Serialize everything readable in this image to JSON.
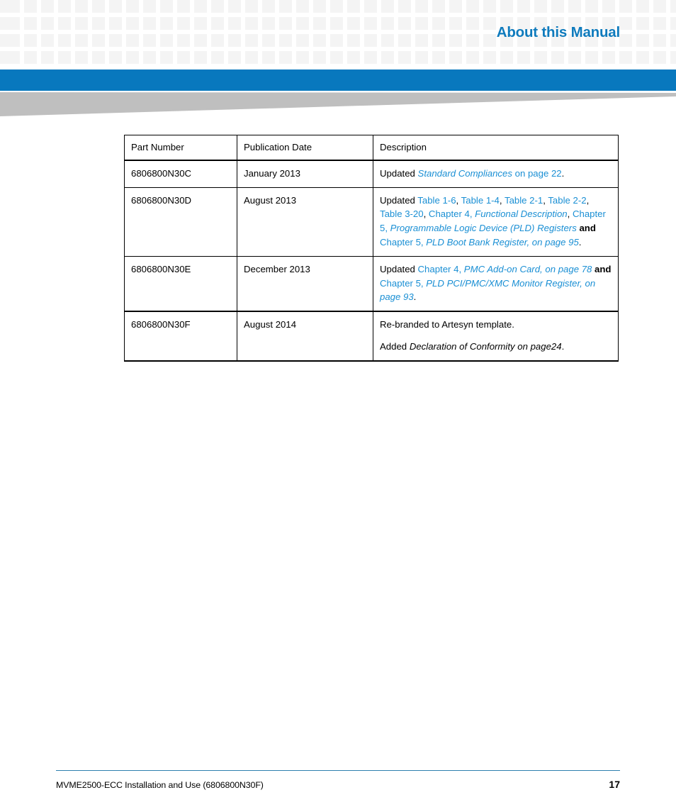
{
  "header": {
    "title": "About this Manual",
    "title_color": "#0f7bbd",
    "band_color": "#0878be",
    "wedge_color": "#bfbfbf",
    "pattern_square_color": "#f4f4f4"
  },
  "table": {
    "columns": [
      "Part Number",
      "Publication Date",
      "Description"
    ],
    "rows": [
      {
        "part_number": "6806800N30C",
        "publication_date": "January 2013",
        "description_plain": "Updated Standard Compliances on page 22."
      },
      {
        "part_number": "6806800N30D",
        "publication_date": "August 2013",
        "description_plain": "Updated Table 1-6, Table 1-4, Table 2-1, Table 2-2, Table 3-20, Chapter 4, Functional Description, Chapter 5, Programmable Logic Device (PLD) Registers and Chapter 5, PLD Boot Bank Register, on page 95."
      },
      {
        "part_number": "6806800N30E",
        "publication_date": "December 2013",
        "description_plain": "Updated Chapter 4, PMC Add-on Card, on page 78 and Chapter 5, PLD PCI/PMC/XMC Monitor Register, on page 93."
      },
      {
        "part_number": "6806800N30F",
        "publication_date": "August 2014",
        "description_plain": "Re-branded to Artesyn template. Added Declaration of Conformity on page24."
      }
    ],
    "row1_desc": {
      "lead": "Updated ",
      "link_italic": "Standard Compliances",
      "link_rest": " on page 22",
      "period": "."
    },
    "row2_desc": {
      "lead": "Updated ",
      "t1": "Table 1-6",
      "sep1": ", ",
      "t2": "Table 1-4",
      "sep2": ", ",
      "t3": "Table 2-1",
      "sep3": ", ",
      "t4": "Table 2-2",
      "sep4": ", ",
      "t5": "Table 3-20",
      "sep5": ", ",
      "c4": "Chapter 4, ",
      "c4_italic": "Functional Description",
      "sep6": ", ",
      "c5a": "Chapter 5, ",
      "c5a_italic": "Programmable Logic Device (PLD) Registers",
      "and": " and ",
      "c5b": "Chapter 5, ",
      "c5b_italic": "PLD Boot Bank Register, on page 95",
      "period": "."
    },
    "row3_desc": {
      "lead": "Updated ",
      "c4": "Chapter 4, ",
      "c4_italic": "PMC Add-on Card, on page 78",
      "and": " and ",
      "c5": "Chapter 5, ",
      "c5_italic": "PLD PCI/PMC/XMC Monitor Register, on page 93",
      "period": "."
    },
    "row4_desc": {
      "line1": "Re-branded to Artesyn template.",
      "line2_lead": "Added ",
      "line2_italic": "Declaration of Conformity on page24",
      "period": "."
    },
    "link_color": "#1a8fd4"
  },
  "footer": {
    "document_title": "MVME2500-ECC Installation and Use (6806800N30F)",
    "page_number": "17",
    "rule_color": "#2e7fae"
  }
}
